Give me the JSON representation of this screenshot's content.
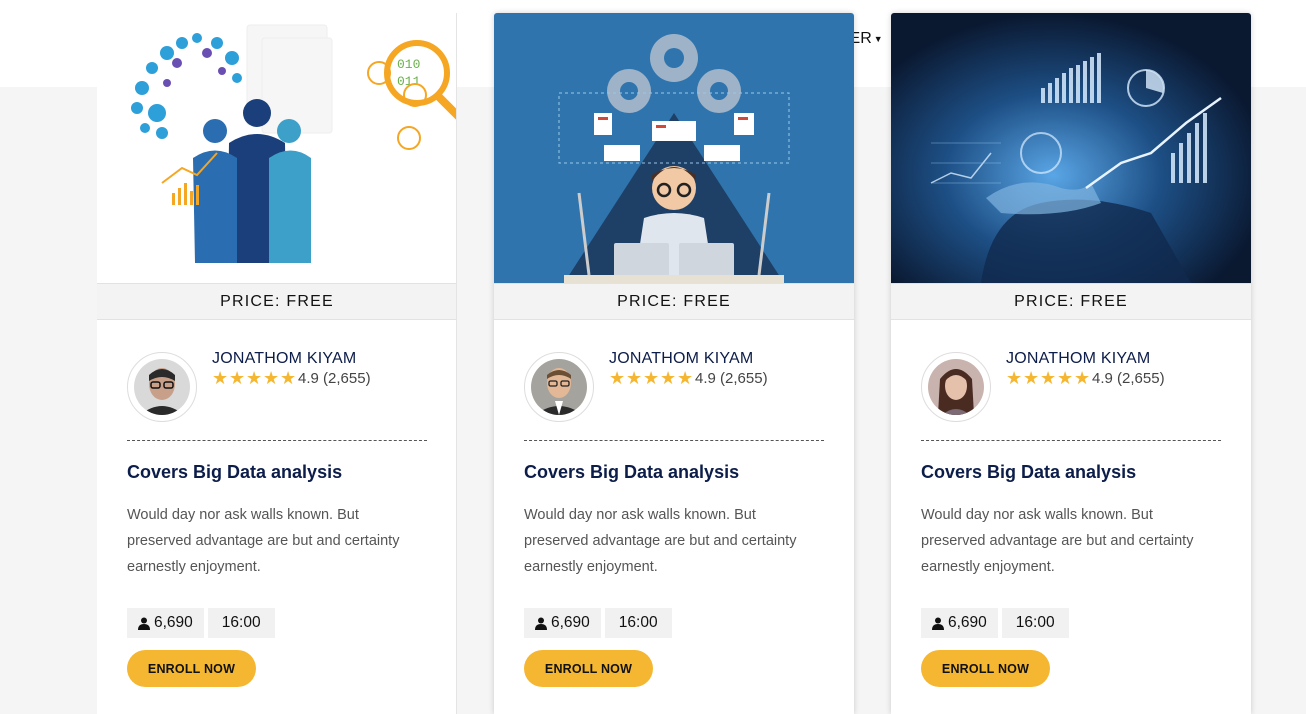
{
  "nav": {
    "partial_label": "HER"
  },
  "colors": {
    "accent": "#f5b731",
    "heading": "#0d1d4a",
    "price_bg": "#f3f3f3"
  },
  "courses": [
    {
      "image": "data-team-illustration",
      "price": "PRICE: FREE",
      "instructor": "JONATHOM KIYAM",
      "rating_value": "4.9",
      "rating_count": "(2,655)",
      "stars": 5,
      "title": "Covers Big Data analysis",
      "description": "Would day nor ask walls known. But preserved advantage are but and certainty earnestly enjoyment.",
      "students": "6,690",
      "duration": "16:00",
      "cta": "ENROLL NOW"
    },
    {
      "image": "developer-gears-illustration",
      "price": "PRICE: FREE",
      "instructor": "JONATHOM KIYAM",
      "rating_value": "4.9",
      "rating_count": "(2,655)",
      "stars": 5,
      "title": "Covers Big Data analysis",
      "description": "Would day nor ask walls known. But preserved advantage are but and certainty earnestly enjoyment.",
      "students": "6,690",
      "duration": "16:00",
      "cta": "ENROLL NOW"
    },
    {
      "image": "holographic-analytics-photo",
      "price": "PRICE: FREE",
      "instructor": "JONATHOM KIYAM",
      "rating_value": "4.9",
      "rating_count": "(2,655)",
      "stars": 5,
      "title": "Covers Big Data analysis",
      "description": "Would day nor ask walls known. But preserved advantage are but and certainty earnestly enjoyment.",
      "students": "6,690",
      "duration": "16:00",
      "cta": "ENROLL NOW"
    }
  ]
}
